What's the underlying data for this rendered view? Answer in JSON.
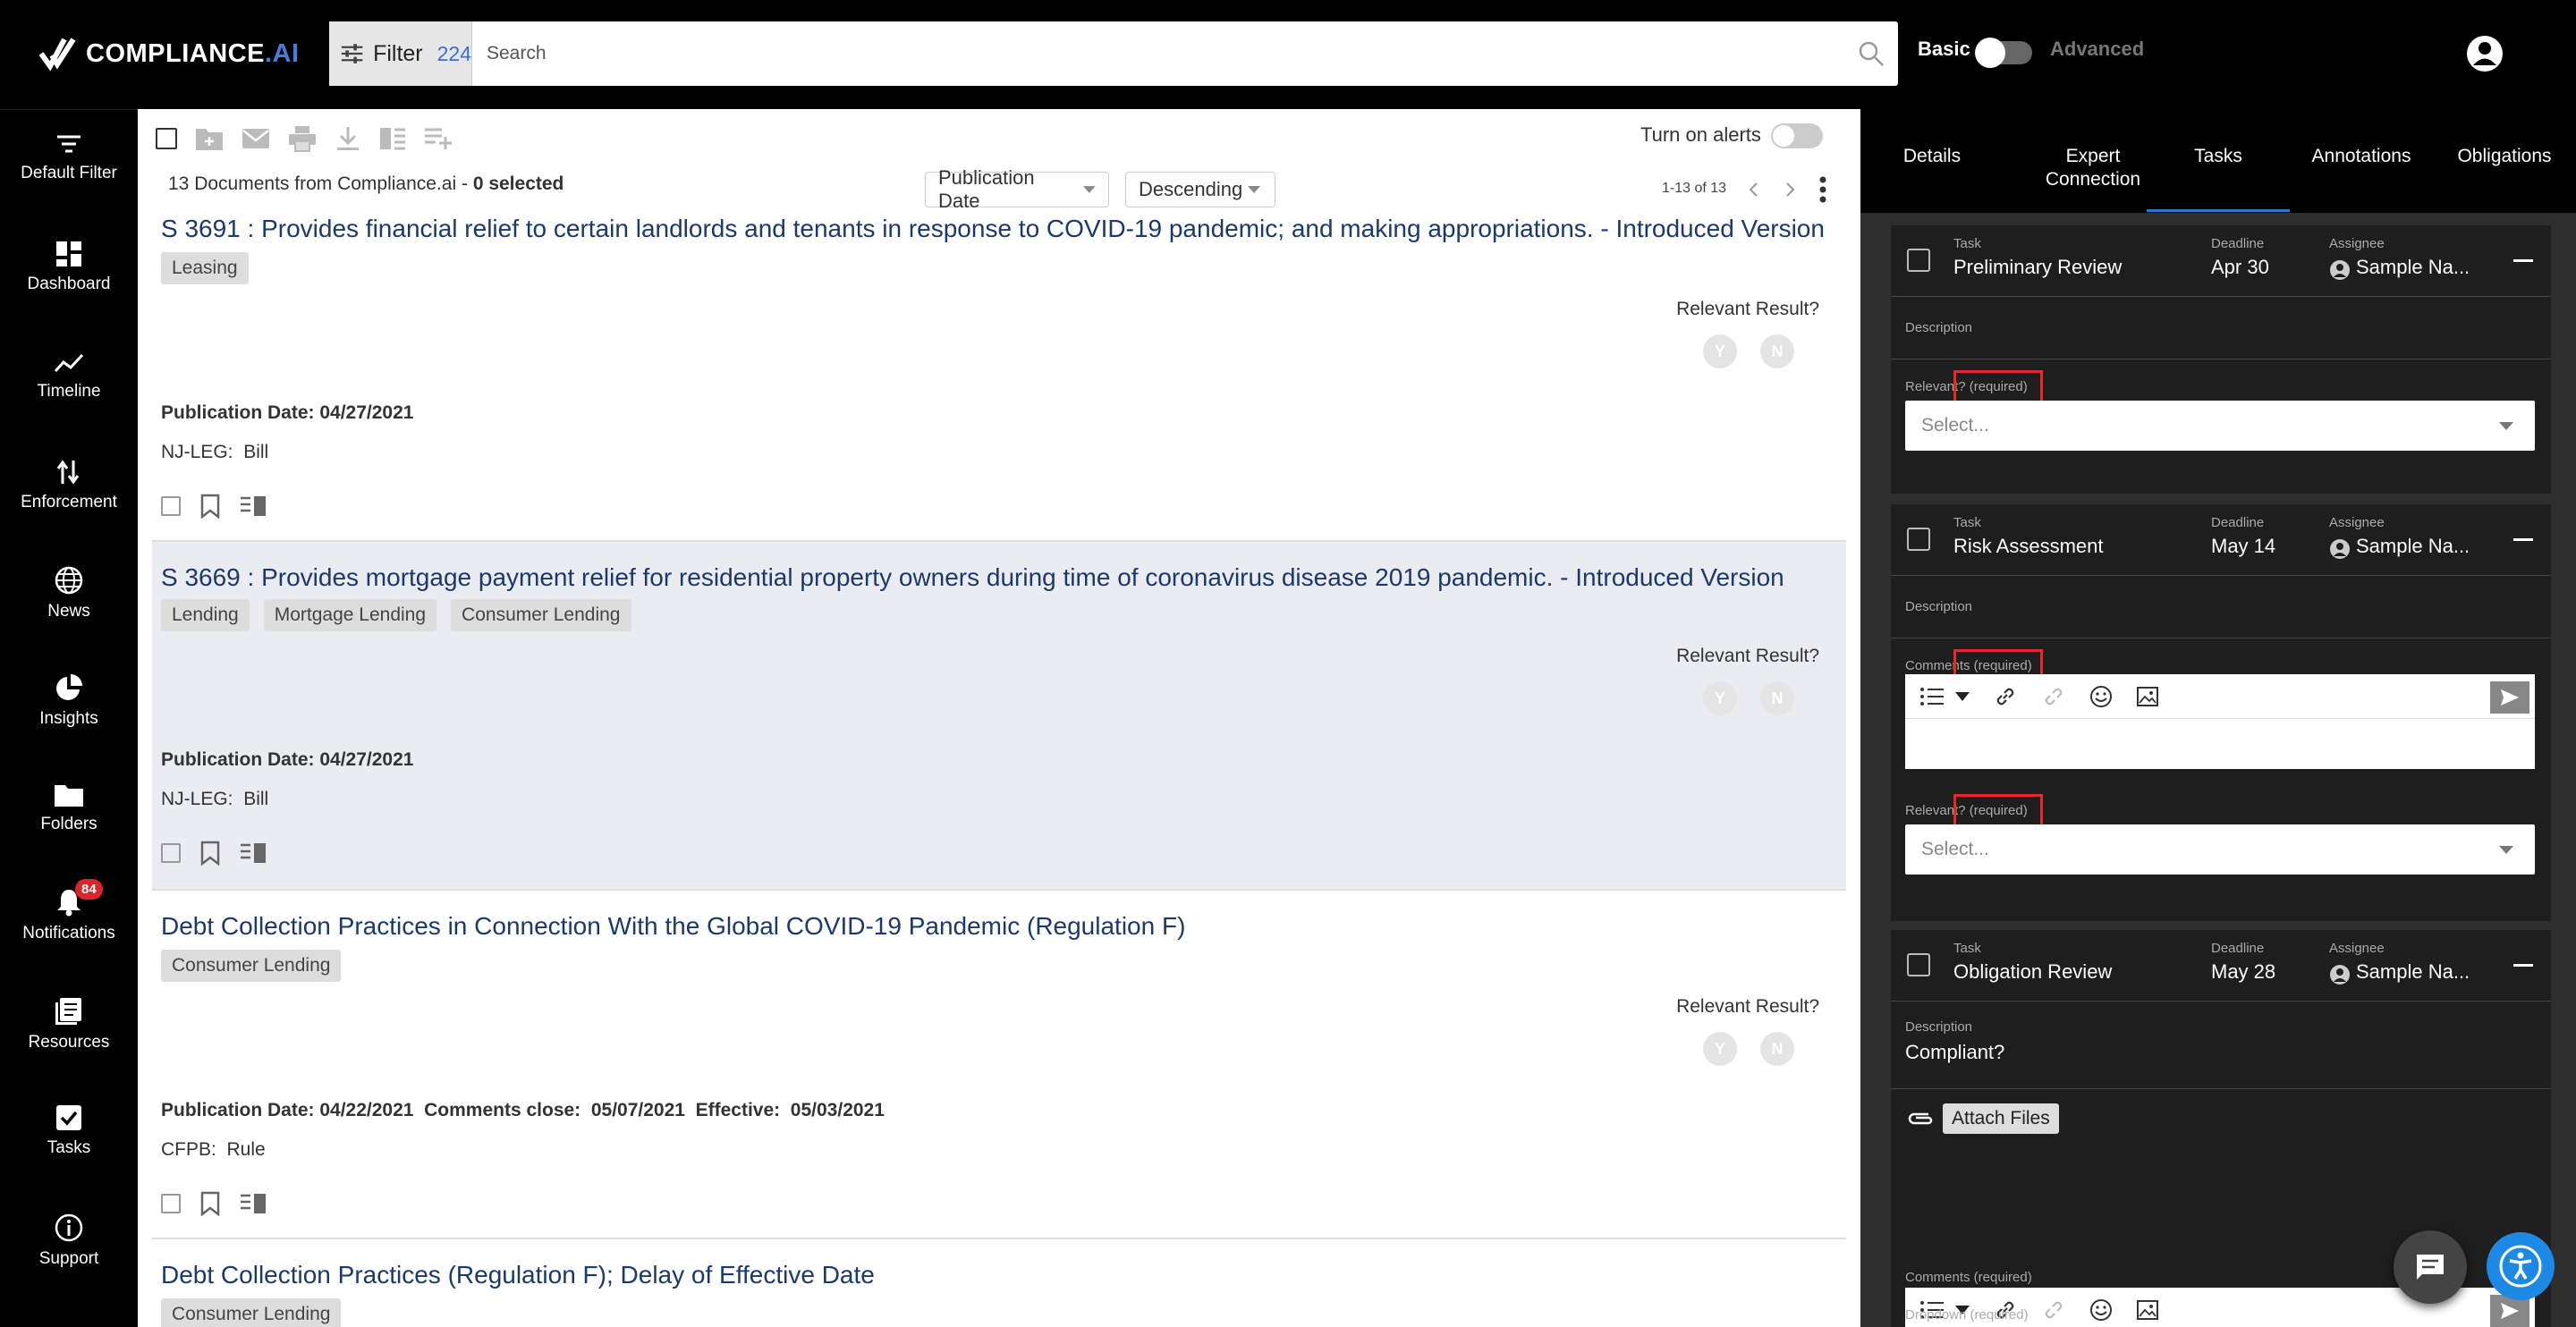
{
  "header": {
    "brand": "COMPLIANCE",
    "brand_suffix": ".AI",
    "filter_label": "Filter",
    "filter_count": "224",
    "search_placeholder": "Search",
    "mode_basic": "Basic",
    "mode_advanced": "Advanced"
  },
  "sidebar": {
    "items": [
      {
        "label": "Default Filter",
        "icon": "filter-lines-icon"
      },
      {
        "label": "Dashboard",
        "icon": "grid-icon"
      },
      {
        "label": "Timeline",
        "icon": "trend-icon"
      },
      {
        "label": "Enforcement",
        "icon": "enforcement-icon"
      },
      {
        "label": "News",
        "icon": "globe-icon"
      },
      {
        "label": "Insights",
        "icon": "pie-icon"
      },
      {
        "label": "Folders",
        "icon": "folder-icon"
      },
      {
        "label": "Notifications",
        "icon": "bell-icon",
        "badge": "84"
      },
      {
        "label": "Resources",
        "icon": "book-icon"
      },
      {
        "label": "Tasks",
        "icon": "check-square-icon"
      },
      {
        "label": "Support",
        "icon": "info-icon"
      }
    ]
  },
  "list": {
    "alerts_label": "Turn on alerts",
    "count_text": "13 Documents from Compliance.ai - ",
    "selected_text": "0 selected",
    "sort_field": "Publication Date",
    "sort_order": "Descending",
    "range": "1-13 of 13",
    "relevant_label": "Relevant Result?",
    "yes": "Y",
    "no": "N",
    "docs": [
      {
        "title": "S 3691 : Provides financial relief to certain landlords and tenants in response to COVID-19 pandemic; and making appropriations. - Introduced Version",
        "tags": [
          "Leasing"
        ],
        "pub": "Publication Date: 04/27/2021",
        "source_agency": "NJ-LEG:",
        "source_type": "Bill"
      },
      {
        "title": "S 3669 : Provides mortgage payment relief for residential property owners during time of coronavirus disease 2019 pandemic. - Introduced Version",
        "tags": [
          "Lending",
          "Mortgage Lending",
          "Consumer Lending"
        ],
        "pub": "Publication Date: 04/27/2021",
        "source_agency": "NJ-LEG:",
        "source_type": "Bill"
      },
      {
        "title": "Debt Collection Practices in Connection With the Global COVID-19 Pandemic (Regulation F)",
        "tags": [
          "Consumer Lending"
        ],
        "pub": "Publication Date: 04/22/2021  Comments close:  05/07/2021  Effective:  05/03/2021",
        "source_agency": "CFPB:",
        "source_type": "Rule"
      },
      {
        "title": "Debt Collection Practices (Regulation F); Delay of Effective Date",
        "tags": [
          "Consumer Lending"
        ]
      }
    ]
  },
  "panel": {
    "tabs": [
      "Details",
      "Expert Connection",
      "Tasks",
      "Annotations",
      "Obligations"
    ],
    "active_tab": "Tasks",
    "task_label": "Task",
    "deadline_label": "Deadline",
    "assignee_label": "Assignee",
    "description_label": "Description",
    "relevant_required": "Relevant? (required)",
    "comments_required": "Comments (required)",
    "dropdown_required": "Dropdown (required)",
    "select_placeholder": "Select...",
    "attach_files": "Attach Files",
    "tasks": [
      {
        "name": "Preliminary Review",
        "deadline": "Apr 30",
        "assignee": "Sample Na..."
      },
      {
        "name": "Risk Assessment",
        "deadline": "May 14",
        "assignee": "Sample Na..."
      },
      {
        "name": "Obligation Review",
        "deadline": "May 28",
        "assignee": "Sample Na...",
        "description": "Compliant?"
      }
    ]
  },
  "colors": {
    "accent": "#3d6fd1",
    "title_link": "#1b3a6b",
    "badge": "#d9262c",
    "highlight_box": "#e52828",
    "fab_accessibility": "#1e88e5"
  }
}
